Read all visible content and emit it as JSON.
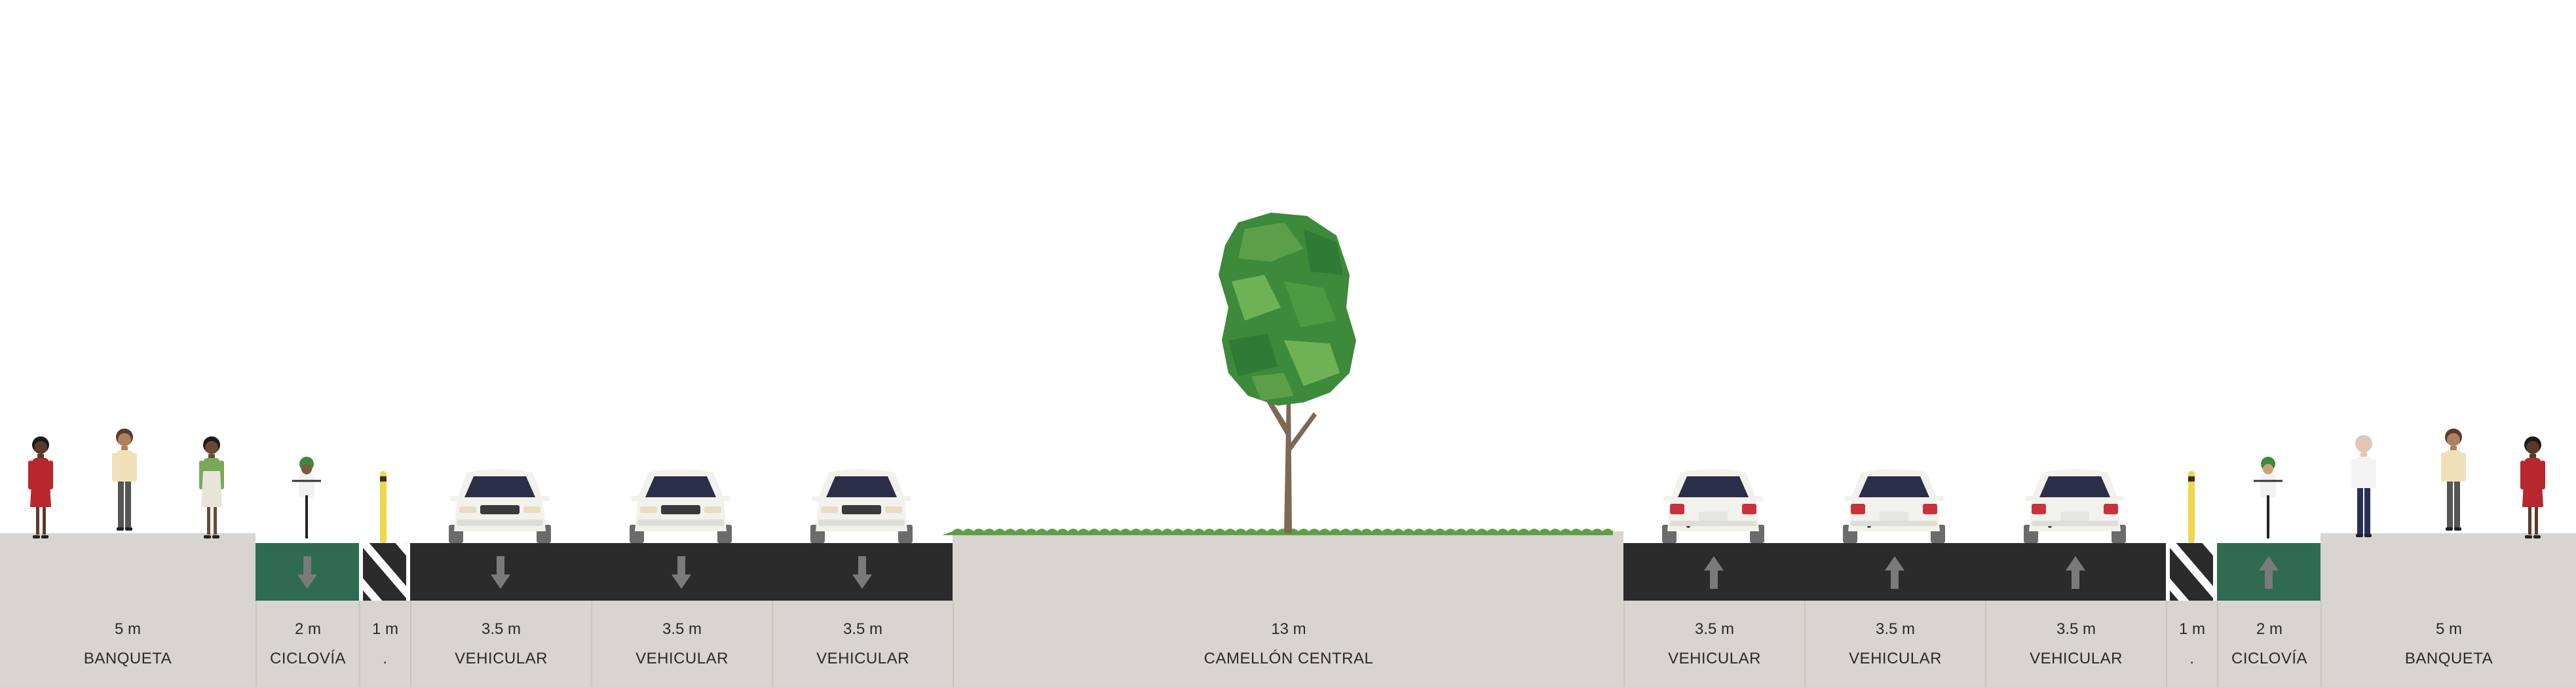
{
  "colors": {
    "sidewalk": "#d8d4cf",
    "asphalt": "#2a2b2a",
    "bike_lane": "#2e6b52",
    "grass": "#5e9f45",
    "arrow": "#7a7a7a",
    "label_text": "#2a2a2a"
  },
  "segments": [
    {
      "width_label": "5 m",
      "name": "BANQUETA",
      "type": "sidewalk"
    },
    {
      "width_label": "2 m",
      "name": "CICLOVÍA",
      "type": "bike-lane",
      "direction": "down"
    },
    {
      "width_label": "1 m",
      "name": ".",
      "type": "buffer"
    },
    {
      "width_label": "3.5 m",
      "name": "VEHICULAR",
      "type": "drive-lane",
      "direction": "down"
    },
    {
      "width_label": "3.5 m",
      "name": "VEHICULAR",
      "type": "drive-lane",
      "direction": "down"
    },
    {
      "width_label": "3.5 m",
      "name": "VEHICULAR",
      "type": "drive-lane",
      "direction": "down"
    },
    {
      "width_label": "13 m",
      "name": "CAMELLÓN CENTRAL",
      "type": "median"
    },
    {
      "width_label": "3.5 m",
      "name": "VEHICULAR",
      "type": "drive-lane",
      "direction": "up"
    },
    {
      "width_label": "3.5 m",
      "name": "VEHICULAR",
      "type": "drive-lane",
      "direction": "up"
    },
    {
      "width_label": "3.5 m",
      "name": "VEHICULAR",
      "type": "drive-lane",
      "direction": "up"
    },
    {
      "width_label": "1 m",
      "name": ".",
      "type": "buffer"
    },
    {
      "width_label": "2 m",
      "name": "CICLOVÍA",
      "type": "bike-lane",
      "direction": "up"
    },
    {
      "width_label": "5 m",
      "name": "BANQUETA",
      "type": "sidewalk"
    }
  ]
}
